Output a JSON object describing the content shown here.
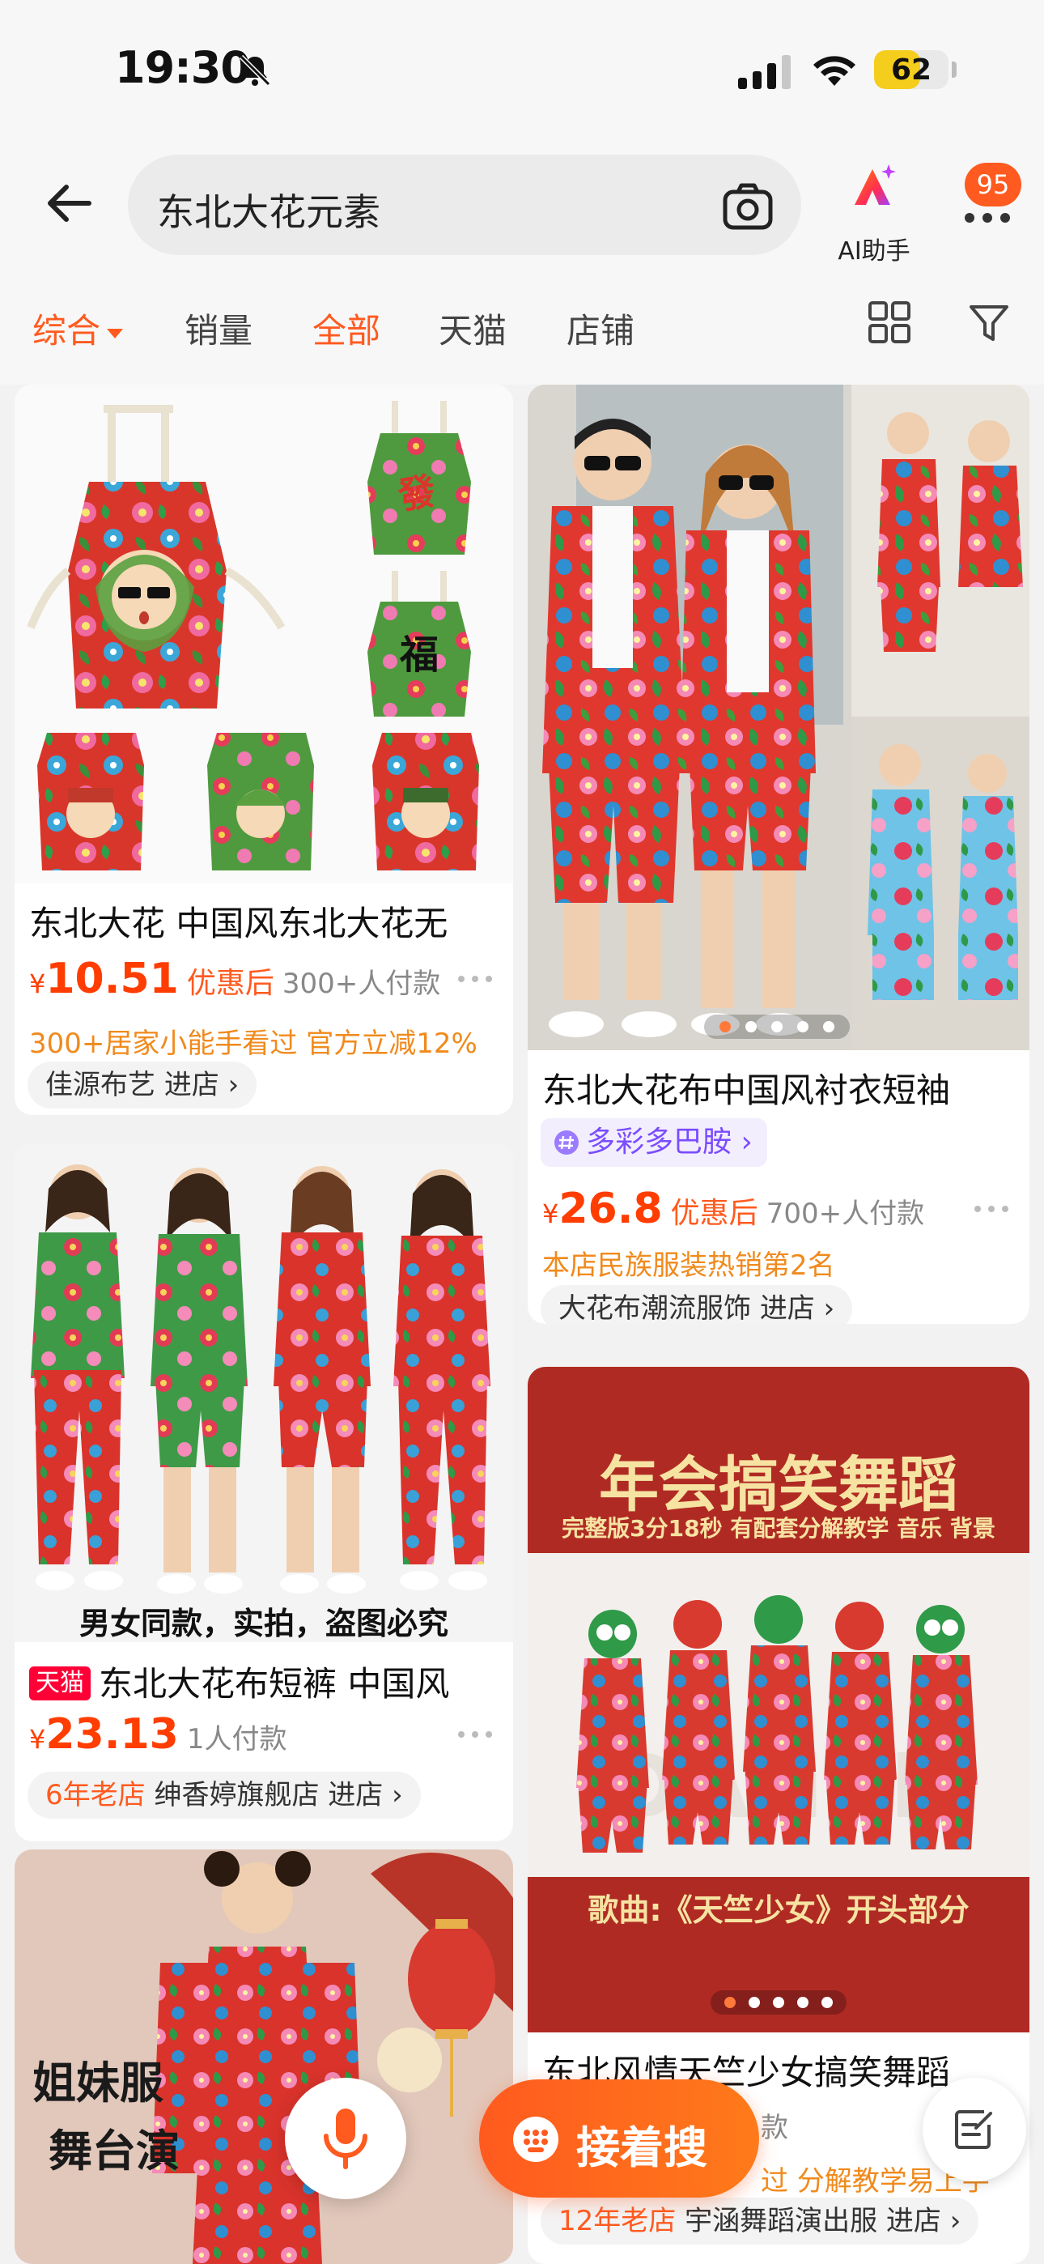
{
  "status_bar": {
    "time": "19:30",
    "battery": "62",
    "battery_level": 0.62
  },
  "header": {
    "search_query": "东北大花元素",
    "ai_label": "AI助手",
    "badge_count": "95"
  },
  "filters": {
    "sort": "综合",
    "items": [
      "销量",
      "全部",
      "天猫",
      "店铺"
    ],
    "active": "全部"
  },
  "products": [
    {
      "title": "东北大花 中国风东北大花无",
      "price_symbol": "¥",
      "price": "10.51",
      "price_tag": "优惠后",
      "sales": "300+人付款",
      "promo_left": "300+居家小能手看过",
      "promo_right": "官方立减12%",
      "shop": "佳源布艺",
      "shop_action": "进店",
      "image_label": "东北大花图案围裙"
    },
    {
      "title": "东北大花布中国风衬衣短袖",
      "brand_pill": "多彩多巴胺",
      "price_symbol": "¥",
      "price": "26.8",
      "price_tag": "优惠后",
      "sales": "700+人付款",
      "promo": "本店民族服装热销第2名",
      "shop": "大花布潮流服饰",
      "shop_action": "进店"
    },
    {
      "title": "东北大花布短裤 中国风",
      "tmall_tag": "天猫",
      "caption": "男女同款，实拍，盗图必究",
      "price_symbol": "¥",
      "price": "23.13",
      "sales": "1人付款",
      "shop_badge": "6年老店",
      "shop": "绅香婷旗舰店",
      "shop_action": "进店"
    },
    {
      "title": "东北风情天竺少女搞笑舞蹈",
      "poster_title": "年会搞笑舞蹈",
      "poster_sub": "完整版3分18秒 有配套分解教学 音乐 背景",
      "poster_song": "歌曲:《天竺少女》开头部分",
      "sales_partial": "款",
      "promo_partial": "过",
      "promo_right": "分解教学易上手",
      "shop_badge": "12年老店",
      "shop": "宇涵舞蹈演出服",
      "shop_action": "进店"
    },
    {
      "poster_line1": "姐妹服",
      "poster_line2": "舞台演"
    }
  ],
  "floating": {
    "search_more": "接着搜"
  },
  "colors": {
    "accent": "#ff5a1f",
    "price": "#ff3d00",
    "promo": "#f08a1c"
  }
}
